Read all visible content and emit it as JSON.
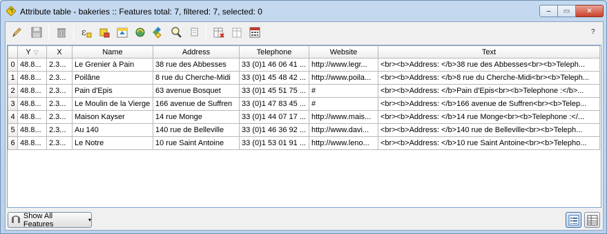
{
  "window": {
    "title": "Attribute table - bakeries :: Features total: 7, filtered: 7, selected: 0",
    "min_label": "‒",
    "max_label": "▭",
    "close_label": "✕"
  },
  "toolbar": {
    "help_label": "?",
    "icons": [
      "edit-pencil-icon",
      "save-edits-icon",
      "delete-selected-icon",
      "expression-select-icon",
      "select-by-expression-icon",
      "move-selection-top-icon",
      "invert-selection-icon",
      "pan-to-selection-icon",
      "zoom-to-selection-icon",
      "copy-rows-icon",
      "delete-column-icon",
      "new-column-icon",
      "field-calculator-icon"
    ]
  },
  "table": {
    "columns": [
      "Y",
      "X",
      "Name",
      "Address",
      "Telephone",
      "Website",
      "Text"
    ],
    "sort_indicator": "▽",
    "rows": [
      {
        "index": "0",
        "cells": [
          "48.8...",
          "2.3...",
          "Le Grenier à Pain",
          "38 rue des Abbesses",
          "33 (0)1 46 06 41 ...",
          "http://www.legr...",
          "<br><b>Address: </b>38 rue des Abbesses<br><b>Teleph..."
        ]
      },
      {
        "index": "1",
        "cells": [
          "48.8...",
          "2.3...",
          "Poilâne",
          "8 rue du Cherche-Midi",
          "33 (0)1 45 48 42 ...",
          "http://www.poila...",
          "<br><b>Address: </b>8 rue du Cherche-Midi<br><b>Teleph..."
        ]
      },
      {
        "index": "2",
        "cells": [
          "48.8...",
          "2.3...",
          "Pain d'Epis",
          "63 avenue Bosquet",
          "33 (0)1 45 51 75 ...",
          "#",
          "<br><b>Address: </b>Pain d'Epis<br><b>Telephone :</b>..."
        ]
      },
      {
        "index": "3",
        "cells": [
          "48.8...",
          "2.3...",
          "Le Moulin de la Vierge",
          "166 avenue de Suffren",
          "33 (0)1 47 83 45 ...",
          "#",
          "<br><b>Address: </b>166 avenue de Suffren<br><b>Telep..."
        ]
      },
      {
        "index": "4",
        "cells": [
          "48.8...",
          "2.3...",
          "Maison Kayser",
          "14 rue Monge",
          "33 (0)1 44 07 17 ...",
          "http://www.mais...",
          "<br><b>Address: </b>14 rue Monge<br><b>Telephone :</..."
        ]
      },
      {
        "index": "5",
        "cells": [
          "48.8...",
          "2.3...",
          "Au 140",
          "140 rue de Belleville",
          "33 (0)1 46 36 92 ...",
          "http://www.davi...",
          "<br><b>Address: </b>140 rue de Belleville<br><b>Teleph..."
        ]
      },
      {
        "index": "6",
        "cells": [
          "48.8...",
          "2.3...",
          "Le Notre",
          "10 rue Saint Antoine",
          "33 (0)1 53 01 91 ...",
          "http://www.leno...",
          "<br><b>Address: </b>10 rue Saint Antoine<br><b>Telepho..."
        ]
      }
    ]
  },
  "bottom": {
    "filter_label": "Show All Features",
    "filter_arrow": "▾"
  }
}
